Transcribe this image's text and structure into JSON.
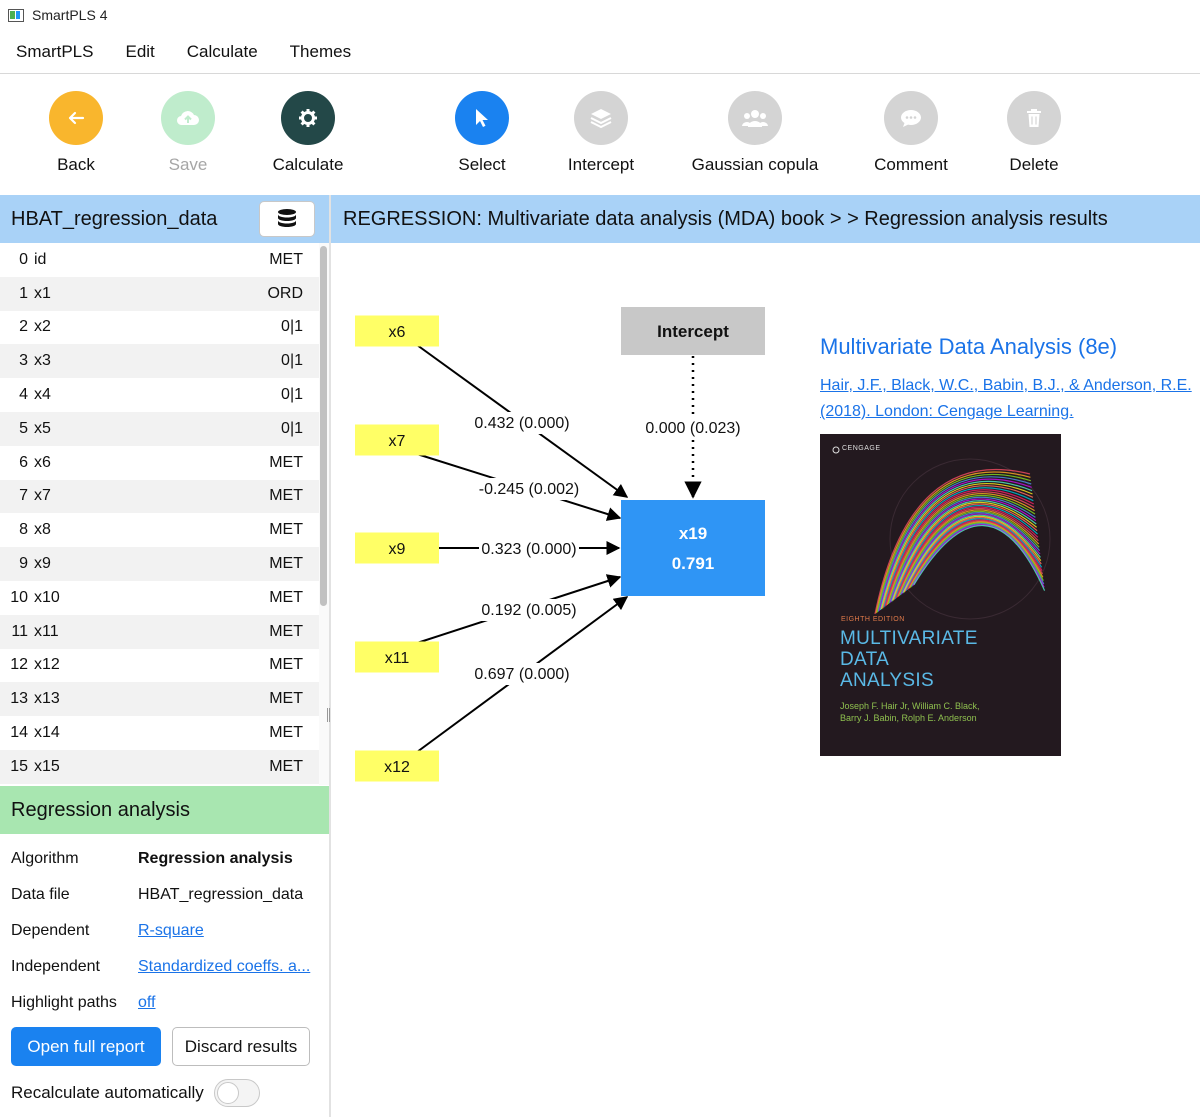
{
  "window": {
    "title": "SmartPLS 4"
  },
  "menu": [
    "SmartPLS",
    "Edit",
    "Calculate",
    "Themes"
  ],
  "toolbar": {
    "back": "Back",
    "save": "Save",
    "calculate": "Calculate",
    "select": "Select",
    "intercept": "Intercept",
    "gaussian": "Gaussian copula",
    "comment": "Comment",
    "delete": "Delete"
  },
  "dataset": {
    "name": "HBAT_regression_data",
    "variables": [
      {
        "index": "0",
        "name": "id",
        "type": "MET"
      },
      {
        "index": "1",
        "name": "x1",
        "type": "ORD"
      },
      {
        "index": "2",
        "name": "x2",
        "type": "0|1"
      },
      {
        "index": "3",
        "name": "x3",
        "type": "0|1"
      },
      {
        "index": "4",
        "name": "x4",
        "type": "0|1"
      },
      {
        "index": "5",
        "name": "x5",
        "type": "0|1"
      },
      {
        "index": "6",
        "name": "x6",
        "type": "MET"
      },
      {
        "index": "7",
        "name": "x7",
        "type": "MET"
      },
      {
        "index": "8",
        "name": "x8",
        "type": "MET"
      },
      {
        "index": "9",
        "name": "x9",
        "type": "MET"
      },
      {
        "index": "10",
        "name": "x10",
        "type": "MET"
      },
      {
        "index": "11",
        "name": "x11",
        "type": "MET"
      },
      {
        "index": "12",
        "name": "x12",
        "type": "MET"
      },
      {
        "index": "13",
        "name": "x13",
        "type": "MET"
      },
      {
        "index": "14",
        "name": "x14",
        "type": "MET"
      },
      {
        "index": "15",
        "name": "x15",
        "type": "MET"
      }
    ]
  },
  "analysis": {
    "header": "Regression analysis",
    "algorithm_label": "Algorithm",
    "algorithm": "Regression analysis",
    "datafile_label": "Data file",
    "datafile": "HBAT_regression_data",
    "dependent_label": "Dependent",
    "dependent": "R-square",
    "independent_label": "Independent",
    "independent": "Standardized coeffs. a...",
    "highlight_label": "Highlight paths",
    "highlight": "off",
    "open_report": "Open full report",
    "discard": "Discard results",
    "recalc": "Recalculate automatically",
    "recalc_on": false
  },
  "model": {
    "header": "REGRESSION: Multivariate data analysis (MDA) book > > Regression analysis results",
    "intercept": {
      "label": "Intercept",
      "value": "0.000 (0.023)"
    },
    "target": {
      "name": "x19",
      "value": "0.791"
    },
    "predictors": [
      {
        "name": "x6",
        "coef": "0.432 (0.000)"
      },
      {
        "name": "x7",
        "coef": "-0.245 (0.002)"
      },
      {
        "name": "x9",
        "coef": "0.323 (0.000)"
      },
      {
        "name": "x11",
        "coef": "0.192 (0.005)"
      },
      {
        "name": "x12",
        "coef": "0.697 (0.000)"
      }
    ],
    "colors": {
      "predictor": "#ffff66",
      "target": "#2f95f5",
      "intercept": "#c8c8c8"
    }
  },
  "book": {
    "title": "Multivariate Data Analysis (8e)",
    "citation": "Hair, J.F., Black, W.C., Babin, B.J., & Anderson, R.E. (2018).  London: Cengage Learning.",
    "cover": {
      "publisher": "CENGAGE",
      "edition": "EIGHTH EDITION",
      "title_lines": [
        "MULTIVARIATE",
        "DATA",
        "ANALYSIS"
      ],
      "authors_lines": [
        "Joseph F. Hair Jr, William C. Black,",
        "Barry J. Babin, Rolph E. Anderson"
      ]
    }
  }
}
